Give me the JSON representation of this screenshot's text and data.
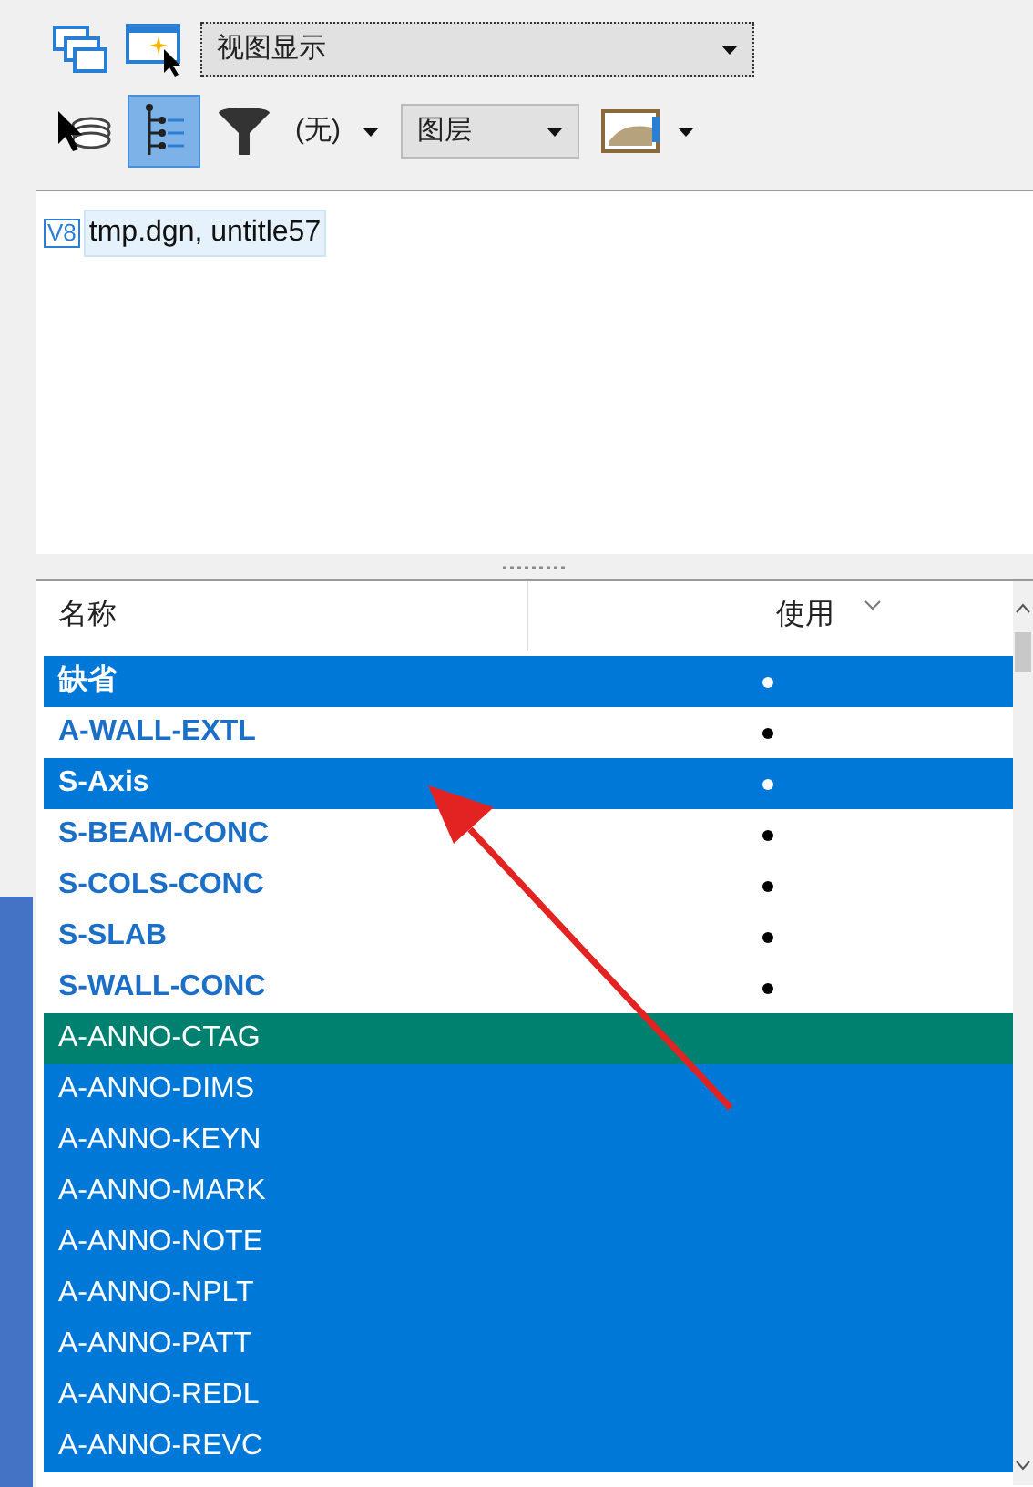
{
  "toolbar_top": {
    "view_dropdown": "视图显示"
  },
  "toolbar_second": {
    "tree_toggle_pressed": true,
    "filter_value": "(无)",
    "mode_dropdown": "图层"
  },
  "tree": {
    "items": [
      {
        "label": "tmp.dgn, untitle57",
        "badge": "V8",
        "selected": true
      }
    ]
  },
  "table": {
    "columns": [
      "名称",
      "使用"
    ],
    "rows": [
      {
        "name": "缺省",
        "used": true,
        "selected": true,
        "focused": false
      },
      {
        "name": "A-WALL-EXTL",
        "used": true,
        "selected": false,
        "focused": false
      },
      {
        "name": "S-Axis",
        "used": true,
        "selected": true,
        "focused": false
      },
      {
        "name": "S-BEAM-CONC",
        "used": true,
        "selected": false,
        "focused": false
      },
      {
        "name": "S-COLS-CONC",
        "used": true,
        "selected": false,
        "focused": false
      },
      {
        "name": "S-SLAB",
        "used": true,
        "selected": false,
        "focused": false
      },
      {
        "name": "S-WALL-CONC",
        "used": true,
        "selected": false,
        "focused": false
      },
      {
        "name": "A-ANNO-CTAG",
        "used": false,
        "selected": true,
        "focused": true
      },
      {
        "name": "A-ANNO-DIMS",
        "used": false,
        "selected": true,
        "focused": false
      },
      {
        "name": "A-ANNO-KEYN",
        "used": false,
        "selected": true,
        "focused": false
      },
      {
        "name": "A-ANNO-MARK",
        "used": false,
        "selected": true,
        "focused": false
      },
      {
        "name": "A-ANNO-NOTE",
        "used": false,
        "selected": true,
        "focused": false
      },
      {
        "name": "A-ANNO-NPLT",
        "used": false,
        "selected": true,
        "focused": false
      },
      {
        "name": "A-ANNO-PATT",
        "used": false,
        "selected": true,
        "focused": false
      },
      {
        "name": "A-ANNO-REDL",
        "used": false,
        "selected": true,
        "focused": false
      },
      {
        "name": "A-ANNO-REVC",
        "used": false,
        "selected": true,
        "focused": false
      }
    ]
  }
}
